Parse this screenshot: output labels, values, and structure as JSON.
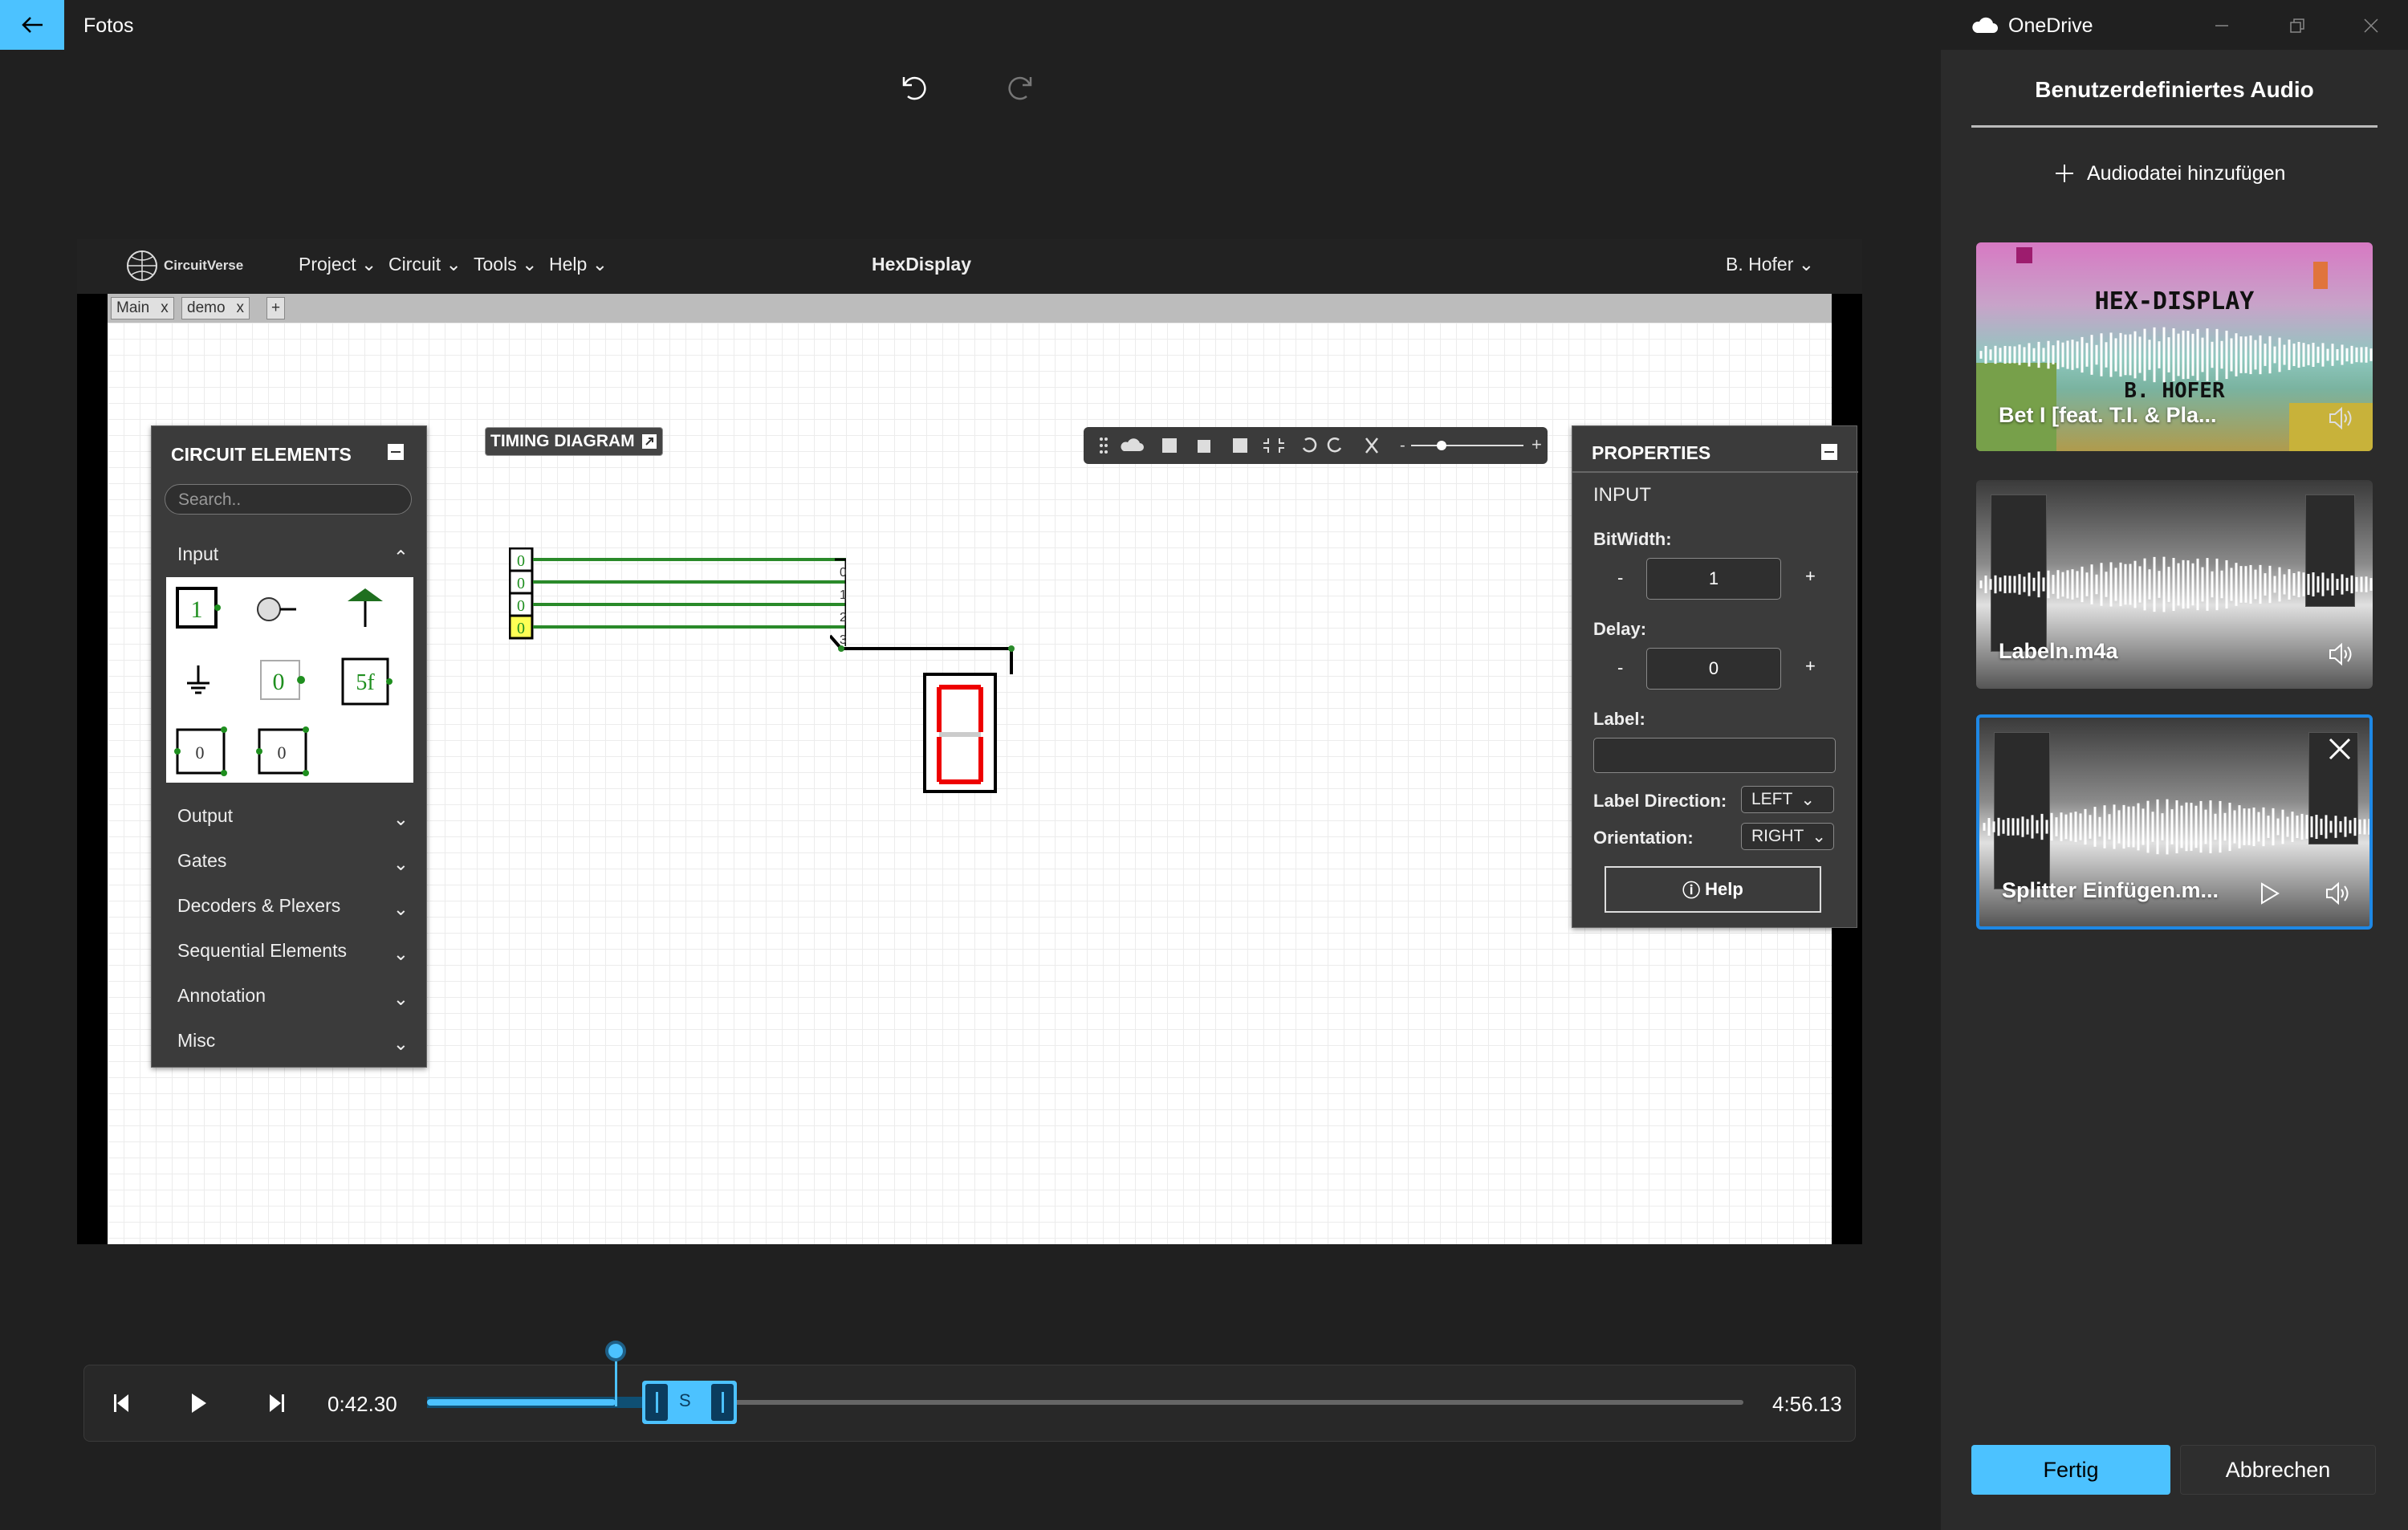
{
  "window": {
    "app_title": "Fotos",
    "onedrive_label": "OneDrive",
    "icons": [
      "back-arrow-icon",
      "cloud-icon",
      "minimize-icon",
      "restore-icon",
      "close-icon",
      "undo-icon",
      "redo-icon"
    ]
  },
  "panel": {
    "title": "Benutzerdefiniertes Audio",
    "add_audio_label": "Audiodatei hinzufügen",
    "cards": [
      {
        "label": "Bet I [feat. T.I. & Pla...",
        "thumb_title": "HEX-DISPLAY",
        "thumb_sub1": "B. HOFER",
        "selected": false
      },
      {
        "label": "Labeln.m4a",
        "selected": false
      },
      {
        "label": "Splitter Einfügen.m...",
        "selected": true
      }
    ],
    "done_label": "Fertig",
    "cancel_label": "Abbrechen",
    "accent_color": "#4cc2ff"
  },
  "video": {
    "logo_text": "CircuitVerse",
    "menus": [
      "Project",
      "Circuit",
      "Tools",
      "Help"
    ],
    "title": "HexDisplay",
    "user": "B. Hofer",
    "tabs": [
      "Main",
      "demo"
    ],
    "tab_close": "x",
    "tab_add": "+",
    "timing_diagram_label": "TIMING DIAGRAM",
    "circuit_elements": {
      "header": "CIRCUIT ELEMENTS",
      "search_placeholder": "Search..",
      "open_category": "Input",
      "categories": [
        "Output",
        "Gates",
        "Decoders & Plexers",
        "Sequential Elements",
        "Annotation",
        "Misc"
      ],
      "grid_glyphs": {
        "one": "1",
        "zero": "0",
        "hex": "5f",
        "clk0": "0",
        "clk1": "0"
      }
    },
    "properties": {
      "header": "PROPERTIES",
      "element": "INPUT",
      "bitwidth_label": "BitWidth:",
      "bitwidth_value": "1",
      "delay_label": "Delay:",
      "delay_value": "0",
      "label_label": "Label:",
      "label_value": "",
      "label_direction_label": "Label Direction:",
      "label_direction_value": "LEFT",
      "orientation_label": "Orientation:",
      "orientation_value": "RIGHT",
      "help_label": "Help",
      "minus": "-",
      "plus": "+"
    },
    "circuit": {
      "inputs": [
        "0",
        "0",
        "0",
        "0"
      ],
      "splitter_labels": [
        "0",
        "1",
        "2",
        "3"
      ]
    }
  },
  "timeline": {
    "current_time": "0:42.30",
    "end_time": "4:56.13",
    "split_label": "S",
    "playhead_fraction": 0.143
  }
}
